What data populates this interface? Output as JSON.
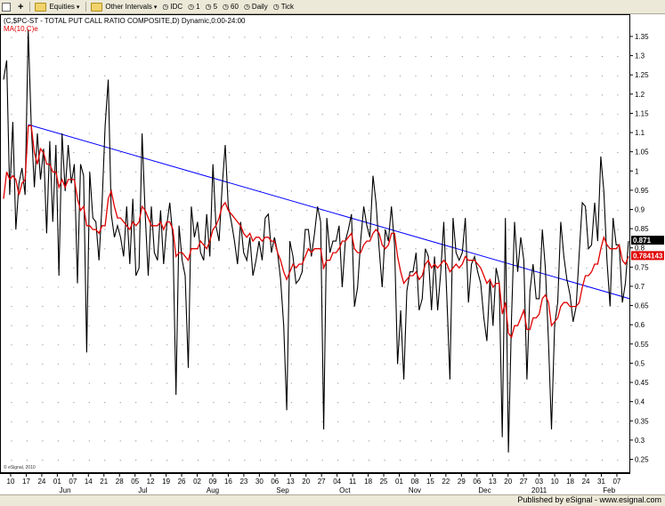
{
  "toolbar": {
    "symbol": "$PC-ST",
    "equities": "Equities",
    "other_intervals": "Other Intervals",
    "idc": "IDC",
    "i1": "1",
    "i5": "5",
    "i60": "60",
    "daily": "Daily",
    "tick": "Tick"
  },
  "title": "(C,$PC-ST - TOTAL PUT CALL RATIO COMPOSITE,D) Dynamic,0:00-24:00",
  "ma_label": "MA(10,C)e",
  "copyright": "© eSignal, 2010",
  "footer": "Published by eSignal - www.esignal.com",
  "colors": {
    "price": "#000000",
    "ma": "#e00000",
    "trend": "#0000ff"
  },
  "chart_data": {
    "type": "line",
    "ylim": [
      0.22,
      1.4
    ],
    "yticks": [
      0.25,
      0.3,
      0.35,
      0.4,
      0.45,
      0.5,
      0.55,
      0.6,
      0.65,
      0.7,
      0.75,
      0.8,
      0.85,
      0.9,
      0.95,
      1,
      1.05,
      1.1,
      1.15,
      1.2,
      1.25,
      1.3,
      1.35
    ],
    "ytick_labels": [
      "0.25",
      "0.3",
      "0.35",
      "0.4",
      "0.45",
      "0.5",
      "0.55",
      "0.6",
      "0.65",
      "0.7",
      "0.75",
      "0.8",
      "0.85",
      "0.9",
      "0.95",
      "1",
      "1.05",
      "1.1",
      "1.15",
      "1.2",
      "1.25",
      "1.3",
      "1.35"
    ],
    "x_days": [
      "10",
      "17",
      "24",
      "01",
      "07",
      "14",
      "21",
      "28",
      "05",
      "12",
      "19",
      "26",
      "02",
      "09",
      "16",
      "23",
      "30",
      "06",
      "13",
      "20",
      "27",
      "04",
      "11",
      "18",
      "25",
      "01",
      "08",
      "15",
      "22",
      "29",
      "06",
      "13",
      "20",
      "27",
      "03",
      "10",
      "18",
      "24",
      "31",
      "07"
    ],
    "x_months": [
      {
        "label": "Jun",
        "at": 3.5
      },
      {
        "label": "Jul",
        "at": 8.5
      },
      {
        "label": "Aug",
        "at": 13.0
      },
      {
        "label": "Sep",
        "at": 17.5
      },
      {
        "label": "Oct",
        "at": 21.5
      },
      {
        "label": "Nov",
        "at": 26.0
      },
      {
        "label": "Dec",
        "at": 30.5
      },
      {
        "label": "2011",
        "at": 34.0
      },
      {
        "label": "Feb",
        "at": 38.5
      }
    ],
    "series": [
      {
        "role": "price",
        "values": [
          1.24,
          1.29,
          0.94,
          1.13,
          0.85,
          0.97,
          1.01,
          0.94,
          1.37,
          1.12,
          0.96,
          1.1,
          0.98,
          1.06,
          0.84,
          1.08,
          0.87,
          1.07,
          0.73,
          1.1,
          0.95,
          1.07,
          0.97,
          1.02,
          0.71,
          1.02,
          0.99,
          0.53,
          1.0,
          0.88,
          0.87,
          0.77,
          0.92,
          1.12,
          1.24,
          0.89,
          0.83,
          0.86,
          0.83,
          0.78,
          0.91,
          0.76,
          0.93,
          0.73,
          0.75,
          1.1,
          0.89,
          0.73,
          0.91,
          0.79,
          0.77,
          0.9,
          0.76,
          0.86,
          0.92,
          0.83,
          0.42,
          0.86,
          0.77,
          0.73,
          0.49,
          0.91,
          0.83,
          0.87,
          0.79,
          0.77,
          0.89,
          0.78,
          1.02,
          0.86,
          0.82,
          0.96,
          1.07,
          0.91,
          0.87,
          0.82,
          0.76,
          0.87,
          0.79,
          0.77,
          0.83,
          0.73,
          0.77,
          0.82,
          0.77,
          0.88,
          0.89,
          0.79,
          0.83,
          0.79,
          0.72,
          0.6,
          0.38,
          0.82,
          0.78,
          0.71,
          0.72,
          0.74,
          0.85,
          0.85,
          0.78,
          0.84,
          0.91,
          0.87,
          0.33,
          0.88,
          0.79,
          0.82,
          0.82,
          0.86,
          0.7,
          0.82,
          0.85,
          0.89,
          0.65,
          0.7,
          0.82,
          0.91,
          0.86,
          0.83,
          0.99,
          0.92,
          0.8,
          0.7,
          0.85,
          0.82,
          0.91,
          0.81,
          0.5,
          0.64,
          0.46,
          0.69,
          0.74,
          0.74,
          0.79,
          0.64,
          0.67,
          0.8,
          0.78,
          0.64,
          0.78,
          0.64,
          0.74,
          0.87,
          0.67,
          0.46,
          0.88,
          0.79,
          0.77,
          0.79,
          0.88,
          0.66,
          0.76,
          0.78,
          0.74,
          0.71,
          0.62,
          0.56,
          0.72,
          0.6,
          0.75,
          0.71,
          0.31,
          0.88,
          0.27,
          0.62,
          0.87,
          0.74,
          0.83,
          0.77,
          0.46,
          0.69,
          0.76,
          0.67,
          0.67,
          0.85,
          0.75,
          0.56,
          0.33,
          0.6,
          0.66,
          0.87,
          0.78,
          0.72,
          0.68,
          0.61,
          0.65,
          0.79,
          0.92,
          0.91,
          0.8,
          0.81,
          0.92,
          0.82,
          1.04,
          0.95,
          0.77,
          0.65,
          0.88,
          0.81,
          0.81,
          0.66,
          0.71,
          0.82
        ]
      },
      {
        "role": "moving-average",
        "values": [
          0.93,
          1.0,
          0.98,
          0.99,
          0.98,
          0.94,
          0.97,
          0.98,
          1.12,
          1.12,
          1.05,
          1.02,
          1.06,
          1.05,
          1.02,
          1.02,
          1.0,
          1.0,
          0.96,
          0.98,
          0.96,
          0.98,
          0.98,
          0.98,
          0.93,
          0.9,
          0.91,
          0.86,
          0.86,
          0.85,
          0.85,
          0.84,
          0.86,
          0.86,
          0.93,
          0.95,
          0.91,
          0.88,
          0.88,
          0.87,
          0.86,
          0.85,
          0.87,
          0.86,
          0.87,
          0.91,
          0.9,
          0.88,
          0.86,
          0.86,
          0.86,
          0.87,
          0.85,
          0.87,
          0.87,
          0.85,
          0.78,
          0.79,
          0.79,
          0.78,
          0.77,
          0.8,
          0.8,
          0.8,
          0.82,
          0.81,
          0.8,
          0.82,
          0.85,
          0.86,
          0.88,
          0.91,
          0.92,
          0.9,
          0.89,
          0.88,
          0.87,
          0.86,
          0.84,
          0.83,
          0.84,
          0.82,
          0.83,
          0.83,
          0.82,
          0.83,
          0.83,
          0.82,
          0.82,
          0.79,
          0.77,
          0.74,
          0.72,
          0.74,
          0.76,
          0.75,
          0.76,
          0.76,
          0.78,
          0.8,
          0.79,
          0.8,
          0.8,
          0.8,
          0.75,
          0.77,
          0.77,
          0.79,
          0.79,
          0.8,
          0.82,
          0.82,
          0.83,
          0.84,
          0.8,
          0.79,
          0.79,
          0.81,
          0.82,
          0.82,
          0.84,
          0.85,
          0.84,
          0.81,
          0.8,
          0.81,
          0.84,
          0.84,
          0.78,
          0.74,
          0.71,
          0.72,
          0.73,
          0.73,
          0.74,
          0.72,
          0.73,
          0.76,
          0.77,
          0.75,
          0.76,
          0.75,
          0.76,
          0.77,
          0.76,
          0.74,
          0.75,
          0.76,
          0.75,
          0.76,
          0.78,
          0.77,
          0.77,
          0.77,
          0.76,
          0.75,
          0.73,
          0.71,
          0.72,
          0.7,
          0.71,
          0.71,
          0.63,
          0.66,
          0.58,
          0.57,
          0.6,
          0.6,
          0.62,
          0.64,
          0.59,
          0.59,
          0.62,
          0.62,
          0.63,
          0.67,
          0.68,
          0.66,
          0.6,
          0.61,
          0.62,
          0.65,
          0.66,
          0.66,
          0.65,
          0.65,
          0.65,
          0.66,
          0.7,
          0.73,
          0.73,
          0.74,
          0.76,
          0.76,
          0.8,
          0.83,
          0.81,
          0.8,
          0.8,
          0.8,
          0.81,
          0.77,
          0.76,
          0.78
        ]
      }
    ],
    "trendline": {
      "start": [
        8,
        1.123
      ],
      "end": [
        206,
        0.664
      ]
    },
    "last_price_tag": "0.871",
    "last_ma_tag": "0.784143"
  }
}
